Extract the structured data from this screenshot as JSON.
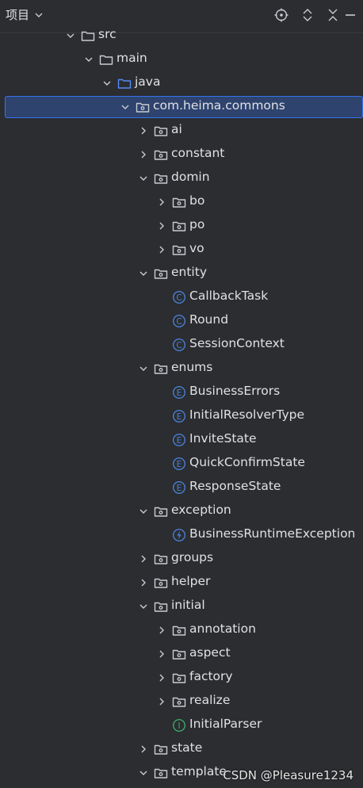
{
  "header": {
    "title": "项目",
    "icons": [
      "target-icon",
      "expand-icon",
      "collapse-icon",
      "close-icon"
    ]
  },
  "tree": [
    {
      "label": "src",
      "kind": "folder",
      "arrow": "down",
      "level": 0
    },
    {
      "label": "main",
      "kind": "folder",
      "arrow": "down",
      "level": 1
    },
    {
      "label": "java",
      "kind": "source-folder",
      "arrow": "down",
      "level": 2
    },
    {
      "label": "com.heima.commons",
      "kind": "package",
      "arrow": "down",
      "level": 3,
      "selected": true
    },
    {
      "label": "ai",
      "kind": "package",
      "arrow": "right",
      "level": 4
    },
    {
      "label": "constant",
      "kind": "package",
      "arrow": "right",
      "level": 4
    },
    {
      "label": "domin",
      "kind": "package",
      "arrow": "down",
      "level": 4
    },
    {
      "label": "bo",
      "kind": "package",
      "arrow": "right",
      "level": 5
    },
    {
      "label": "po",
      "kind": "package",
      "arrow": "right",
      "level": 5
    },
    {
      "label": "vo",
      "kind": "package",
      "arrow": "right",
      "level": 5
    },
    {
      "label": "entity",
      "kind": "package",
      "arrow": "down",
      "level": 4
    },
    {
      "label": "CallbackTask",
      "kind": "class",
      "arrow": "none",
      "level": 5
    },
    {
      "label": "Round",
      "kind": "class",
      "arrow": "none",
      "level": 5
    },
    {
      "label": "SessionContext",
      "kind": "class",
      "arrow": "none",
      "level": 5
    },
    {
      "label": "enums",
      "kind": "package",
      "arrow": "down",
      "level": 4
    },
    {
      "label": "BusinessErrors",
      "kind": "enum",
      "arrow": "none",
      "level": 5
    },
    {
      "label": "InitialResolverType",
      "kind": "enum",
      "arrow": "none",
      "level": 5
    },
    {
      "label": "InviteState",
      "kind": "enum",
      "arrow": "none",
      "level": 5
    },
    {
      "label": "QuickConfirmState",
      "kind": "enum",
      "arrow": "none",
      "level": 5
    },
    {
      "label": "ResponseState",
      "kind": "enum",
      "arrow": "none",
      "level": 5
    },
    {
      "label": "exception",
      "kind": "package",
      "arrow": "down",
      "level": 4
    },
    {
      "label": "BusinessRuntimeException",
      "kind": "exception",
      "arrow": "none",
      "level": 5
    },
    {
      "label": "groups",
      "kind": "package",
      "arrow": "right",
      "level": 4
    },
    {
      "label": "helper",
      "kind": "package",
      "arrow": "right",
      "level": 4
    },
    {
      "label": "initial",
      "kind": "package",
      "arrow": "down",
      "level": 4
    },
    {
      "label": "annotation",
      "kind": "package",
      "arrow": "right",
      "level": 5
    },
    {
      "label": "aspect",
      "kind": "package",
      "arrow": "right",
      "level": 5
    },
    {
      "label": "factory",
      "kind": "package",
      "arrow": "right",
      "level": 5
    },
    {
      "label": "realize",
      "kind": "package",
      "arrow": "right",
      "level": 5
    },
    {
      "label": "InitialParser",
      "kind": "interface",
      "arrow": "none",
      "level": 5
    },
    {
      "label": "state",
      "kind": "package",
      "arrow": "right",
      "level": 4
    },
    {
      "label": "template",
      "kind": "package",
      "arrow": "down",
      "level": 4
    }
  ],
  "watermark": "CSDN @Pleasure1234",
  "colors": {
    "background": "#2b2d30",
    "selection": "#2e436e",
    "selection_border": "#3574f0",
    "class_icon": "#4a7fd4",
    "interface_icon": "#3ea86b"
  }
}
